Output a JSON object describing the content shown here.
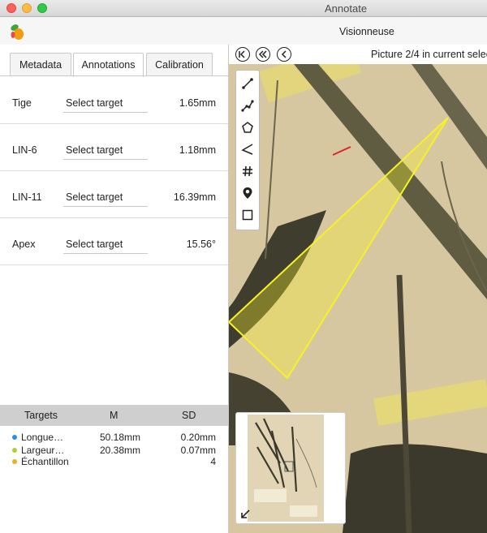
{
  "window": {
    "title": "Annotate"
  },
  "header": {
    "viewer_title": "Visionneuse"
  },
  "tabs": [
    {
      "label": "Metadata",
      "active": false
    },
    {
      "label": "Annotations",
      "active": true
    },
    {
      "label": "Calibration",
      "active": false
    }
  ],
  "annotations": [
    {
      "label": "Tige",
      "target": "Select target",
      "value": "1.65mm"
    },
    {
      "label": "LIN-6",
      "target": "Select target",
      "value": "1.18mm"
    },
    {
      "label": "LIN-11",
      "target": "Select target",
      "value": "16.39mm"
    },
    {
      "label": "Apex",
      "target": "Select target",
      "value": "15.56°"
    }
  ],
  "targets_table": {
    "headers": [
      "Targets",
      "M",
      "SD"
    ],
    "rows": [
      {
        "name": "Longue…",
        "m": "50.18mm",
        "sd": "0.20mm",
        "color": "#2b8fe0"
      },
      {
        "name": "Largeur…",
        "m": "20.38mm",
        "sd": "0.07mm",
        "color": "#b8cc2c"
      },
      {
        "name": "Échantillon",
        "m": "",
        "sd": "4",
        "color": "#e5b421"
      }
    ]
  },
  "viewer": {
    "picture_info": "Picture 2/4 in current selec",
    "nav_icons": [
      "first-page-icon",
      "previous-page-icon",
      "previous-icon"
    ]
  },
  "tools": [
    "line-tool-icon",
    "polyline-tool-icon",
    "polygon-tool-icon",
    "angle-tool-icon",
    "count-tool-icon",
    "point-tool-icon",
    "rectangle-tool-icon"
  ],
  "colors": {
    "annotation": "#f6f22a",
    "measure_line": "#d8262a",
    "panel_header": "#cfcfcf"
  }
}
